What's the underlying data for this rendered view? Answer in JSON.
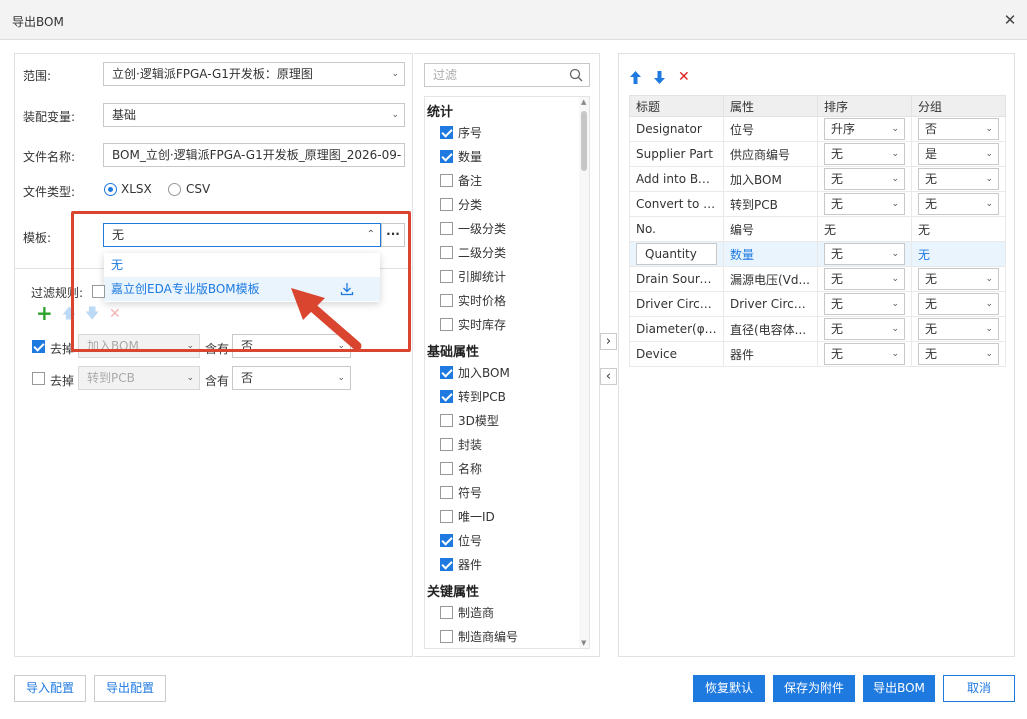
{
  "dialog": {
    "title": "导出BOM",
    "close_icon": "close-icon"
  },
  "left": {
    "scope_label": "范围:",
    "scope_value": "立创·逻辑派FPGA-G1开发板：原理图",
    "assembly_label": "装配变量:",
    "assembly_value": "基础",
    "filename_label": "文件名称:",
    "filename_value": "BOM_立创·逻辑派FPGA-G1开发板_原理图_2026-09-",
    "filetype_label": "文件类型:",
    "filetype_options": [
      "XLSX",
      "CSV"
    ],
    "filetype_selected": "XLSX",
    "template_label": "模板:",
    "template_value": "无",
    "template_more": "···",
    "template_options": [
      "无",
      "嘉立创EDA专业版BOM模板"
    ],
    "filter_rules_label": "过滤规则:",
    "rules": [
      {
        "checked": true,
        "action": "去掉",
        "field": "加入BOM",
        "contains": "含有",
        "value": "否"
      },
      {
        "checked": false,
        "action": "去掉",
        "field": "转到PCB",
        "contains": "含有",
        "value": "否"
      }
    ]
  },
  "middle": {
    "filter_placeholder": "过滤",
    "groups": [
      {
        "title": "统计",
        "items": [
          {
            "label": "序号",
            "checked": true
          },
          {
            "label": "数量",
            "checked": true
          },
          {
            "label": "备注",
            "checked": false
          },
          {
            "label": "分类",
            "checked": false
          },
          {
            "label": "一级分类",
            "checked": false
          },
          {
            "label": "二级分类",
            "checked": false
          },
          {
            "label": "引脚统计",
            "checked": false
          },
          {
            "label": "实时价格",
            "checked": false
          },
          {
            "label": "实时库存",
            "checked": false
          }
        ]
      },
      {
        "title": "基础属性",
        "items": [
          {
            "label": "加入BOM",
            "checked": true
          },
          {
            "label": "转到PCB",
            "checked": true
          },
          {
            "label": "3D模型",
            "checked": false
          },
          {
            "label": "封装",
            "checked": false
          },
          {
            "label": "名称",
            "checked": false
          },
          {
            "label": "符号",
            "checked": false
          },
          {
            "label": "唯一ID",
            "checked": false
          },
          {
            "label": "位号",
            "checked": true
          },
          {
            "label": "器件",
            "checked": true
          }
        ]
      },
      {
        "title": "关键属性",
        "items": [
          {
            "label": "制造商",
            "checked": false
          },
          {
            "label": "制造商编号",
            "checked": false
          }
        ]
      }
    ],
    "move_right": "›",
    "move_left": "‹"
  },
  "right": {
    "headers": [
      "标题",
      "属性",
      "排序",
      "分组"
    ],
    "rows": [
      {
        "title": "Designator",
        "attr": "位号",
        "sort": "升序",
        "group": "否",
        "sort_select": true,
        "group_select": true
      },
      {
        "title": "Supplier Part",
        "attr": "供应商编号",
        "sort": "无",
        "group": "是",
        "sort_select": true,
        "group_select": true
      },
      {
        "title": "Add into BOM",
        "attr": "加入BOM",
        "sort": "无",
        "group": "无",
        "sort_select": true,
        "group_select": true
      },
      {
        "title": "Convert to P...",
        "attr": "转到PCB",
        "sort": "无",
        "group": "无",
        "sort_select": true,
        "group_select": true
      },
      {
        "title": "No.",
        "attr": "编号",
        "sort": "无",
        "group": "无",
        "sort_select": false,
        "group_select": false
      },
      {
        "title": "Quantity",
        "attr": "数量",
        "sort": "无",
        "group": "无",
        "sort_select": true,
        "group_select": false
      },
      {
        "title": "Drain Sourc...",
        "attr": "漏源电压(Vd...",
        "sort": "无",
        "group": "无",
        "sort_select": true,
        "group_select": true
      },
      {
        "title": "Driver Circuitry",
        "attr": "Driver Circuitry",
        "sort": "无",
        "group": "无",
        "sort_select": true,
        "group_select": true
      },
      {
        "title": "Diameter(φD)",
        "attr": "直径(电容体...",
        "sort": "无",
        "group": "无",
        "sort_select": true,
        "group_select": true
      },
      {
        "title": "Device",
        "attr": "器件",
        "sort": "无",
        "group": "无",
        "sort_select": true,
        "group_select": true
      }
    ]
  },
  "footer": {
    "import_config": "导入配置",
    "export_config": "导出配置",
    "restore_default": "恢复默认",
    "save_attachment": "保存为附件",
    "export_bom": "导出BOM",
    "cancel": "取消"
  },
  "colors": {
    "accent": "#1f7ae0",
    "highlight_box": "#d9452e",
    "delete": "#e02020",
    "add": "#2aa22a"
  }
}
